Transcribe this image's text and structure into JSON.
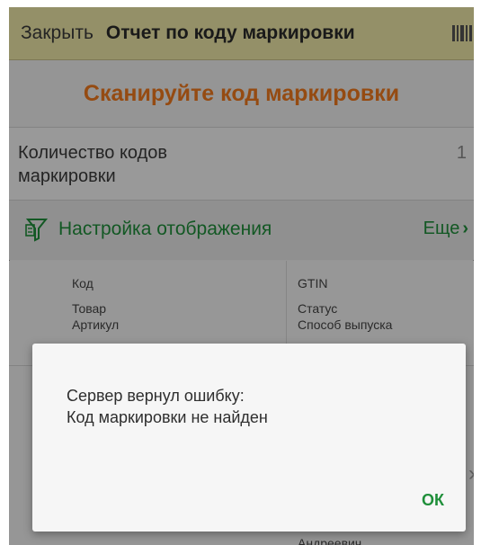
{
  "header": {
    "close_label": "Закрыть",
    "title": "Отчет по коду маркировки",
    "barcode_icon": "barcode-icon"
  },
  "scan_prompt": "Сканируйте код маркировки",
  "count": {
    "label": "Количество кодов маркировки",
    "value": "1"
  },
  "settings": {
    "icon": "filter-settings-icon",
    "label": "Настройка отображения",
    "more_label": "Еще",
    "more_icon": "chevron-right-icon"
  },
  "fields": {
    "left": [
      "Код",
      "Товар",
      "Артикул"
    ],
    "right": [
      "GTIN",
      "Статус",
      "Способ выпуска"
    ]
  },
  "background_peek": "Андреевич",
  "dialog": {
    "line1": "Сервер вернул ошибку:",
    "line2": "Код маркировки не найден",
    "ok_label": "ОК"
  },
  "colors": {
    "accent_green": "#1f8f3a",
    "accent_orange": "#f07a1d",
    "header_bg": "#efe9a8"
  }
}
